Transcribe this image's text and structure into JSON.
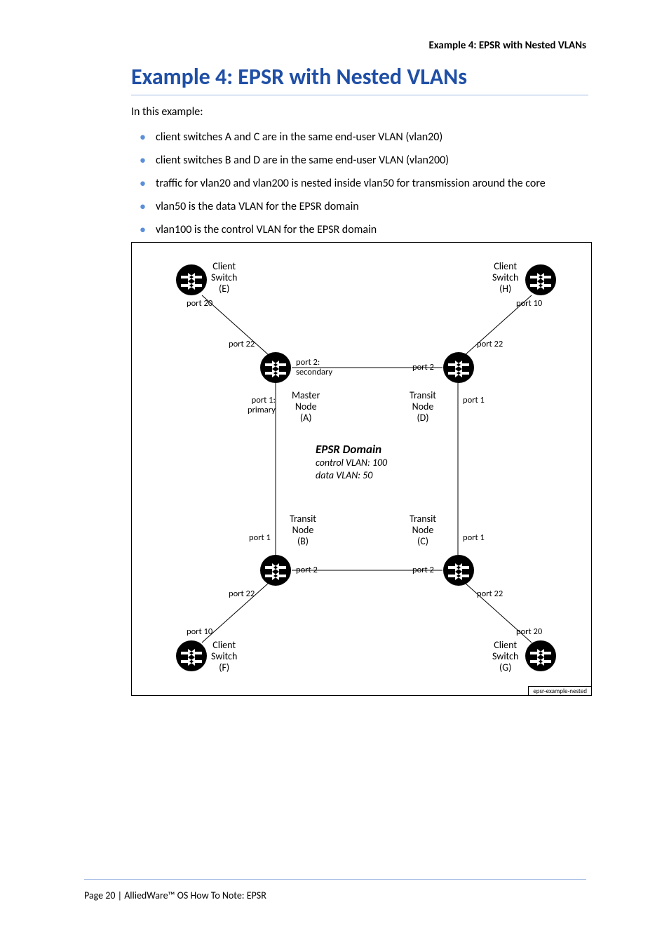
{
  "header": {
    "right": "Example 4: EPSR with Nested VLANs"
  },
  "title": "Example 4: EPSR with Nested VLANs",
  "intro": "In this example:",
  "bullets": [
    "client switches A and C are in the same end-user VLAN (vlan20)",
    "client switches B and D are in the same end-user VLAN (vlan200)",
    "traffic for vlan20 and vlan200 is nested inside vlan50 for transmission around the core",
    "vlan50 is the data VLAN for the EPSR domain",
    "vlan100 is the control VLAN for the EPSR domain"
  ],
  "figure": {
    "caption": "epsr-example-nested",
    "domain": {
      "title": "EPSR Domain",
      "control": "control VLAN: 100",
      "data": "data VLAN: 50"
    },
    "nodes": {
      "E": {
        "l1": "Client",
        "l2": "Switch",
        "l3": "(E)"
      },
      "H": {
        "l1": "Client",
        "l2": "Switch",
        "l3": "(H)"
      },
      "F": {
        "l1": "Client",
        "l2": "Switch",
        "l3": "(F)"
      },
      "G": {
        "l1": "Client",
        "l2": "Switch",
        "l3": "(G)"
      },
      "A": {
        "l1": "Master",
        "l2": "Node",
        "l3": "(A)"
      },
      "D": {
        "l1": "Transit",
        "l2": "Node",
        "l3": "(D)"
      },
      "B": {
        "l1": "Transit",
        "l2": "Node",
        "l3": "(B)"
      },
      "C": {
        "l1": "Transit",
        "l2": "Node",
        "l3": "(C)"
      }
    },
    "ports": {
      "e_p20": "port 20",
      "h_p10": "port 10",
      "a_p22": "port 22",
      "d_p22": "port 22",
      "a_p2_l1": "port 2:",
      "a_p2_l2": "secondary",
      "d_p2": "port 2",
      "a_p1_l1": "port 1:",
      "a_p1_l2": "primary",
      "d_p1": "port 1",
      "b_p1": "port 1",
      "c_p1": "port 1",
      "b_p2": "port 2",
      "c_p2": "port 2",
      "b_p22": "port 22",
      "c_p22": "port 22",
      "f_p10": "port 10",
      "g_p20": "port 20"
    }
  },
  "footer": {
    "left": "Page 20 | AlliedWare™ OS How To Note: EPSR"
  }
}
